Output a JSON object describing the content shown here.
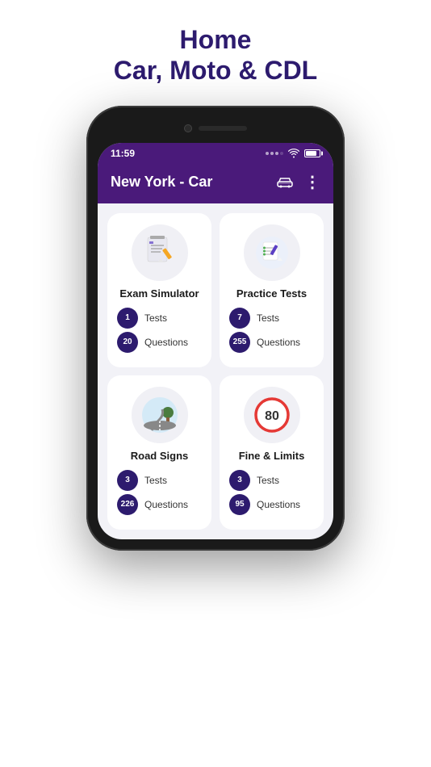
{
  "page": {
    "title_line1": "Home",
    "title_line2": "Car, Moto & CDL"
  },
  "status_bar": {
    "time": "11:59",
    "signal": "...",
    "wifi": "wifi",
    "battery": "battery"
  },
  "header": {
    "title": "New York - Car"
  },
  "cards": [
    {
      "id": "exam-simulator",
      "title": "Exam Simulator",
      "stats": [
        {
          "badge": "1",
          "label": "Tests"
        },
        {
          "badge": "20",
          "label": "Questions"
        }
      ]
    },
    {
      "id": "practice-tests",
      "title": "Practice Tests",
      "stats": [
        {
          "badge": "7",
          "label": "Tests"
        },
        {
          "badge": "255",
          "label": "Questions"
        }
      ]
    },
    {
      "id": "road-signs",
      "title": "Road Signs",
      "stats": [
        {
          "badge": "3",
          "label": "Tests"
        },
        {
          "badge": "226",
          "label": "Questions"
        }
      ]
    },
    {
      "id": "fine-limits",
      "title": "Fine & Limits",
      "stats": [
        {
          "badge": "3",
          "label": "Tests"
        },
        {
          "badge": "95",
          "label": "Questions"
        }
      ]
    }
  ]
}
